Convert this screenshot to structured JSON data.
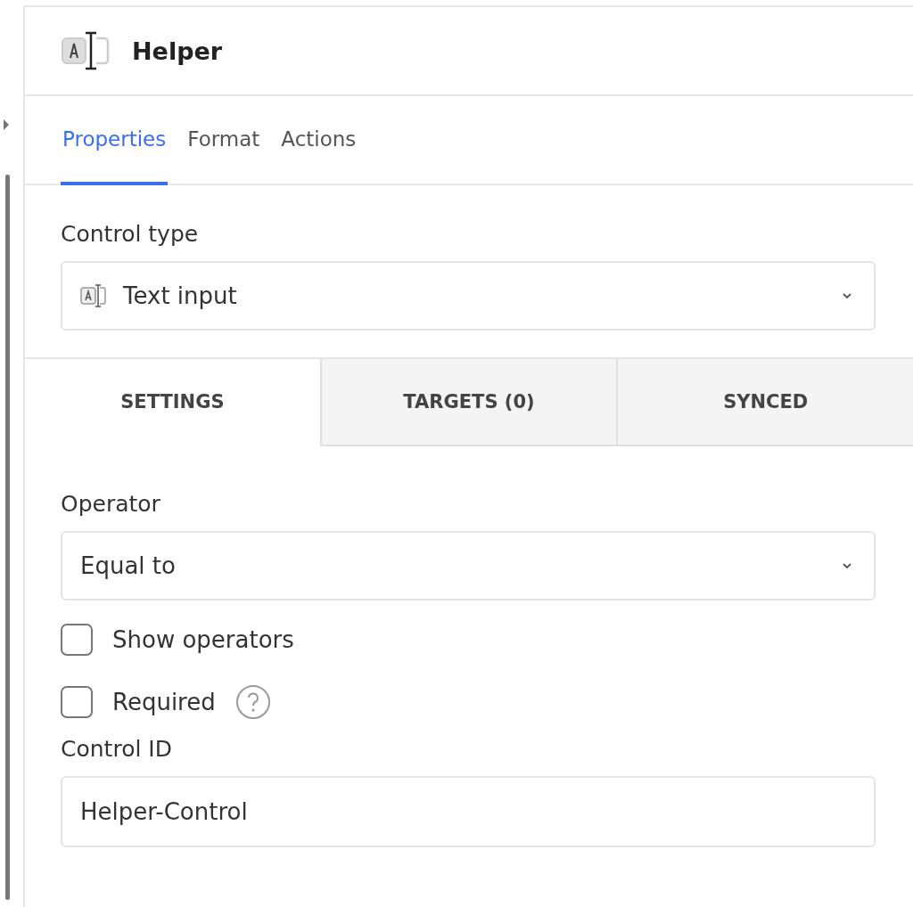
{
  "header": {
    "title": "Helper"
  },
  "tabs": [
    {
      "label": "Properties",
      "selected": true
    },
    {
      "label": "Format",
      "selected": false
    },
    {
      "label": "Actions",
      "selected": false
    }
  ],
  "control_type": {
    "label": "Control type",
    "value": "Text input"
  },
  "section_tabs": [
    {
      "label": "SETTINGS",
      "selected": true
    },
    {
      "label": "TARGETS (0)",
      "selected": false
    },
    {
      "label": "SYNCED",
      "selected": false
    }
  ],
  "operator": {
    "label": "Operator",
    "value": "Equal to"
  },
  "checkboxes": [
    {
      "label": "Show operators",
      "checked": false,
      "help": false
    },
    {
      "label": "Required",
      "checked": false,
      "help": true
    }
  ],
  "control_id": {
    "label": "Control ID",
    "value": "Helper-Control"
  }
}
